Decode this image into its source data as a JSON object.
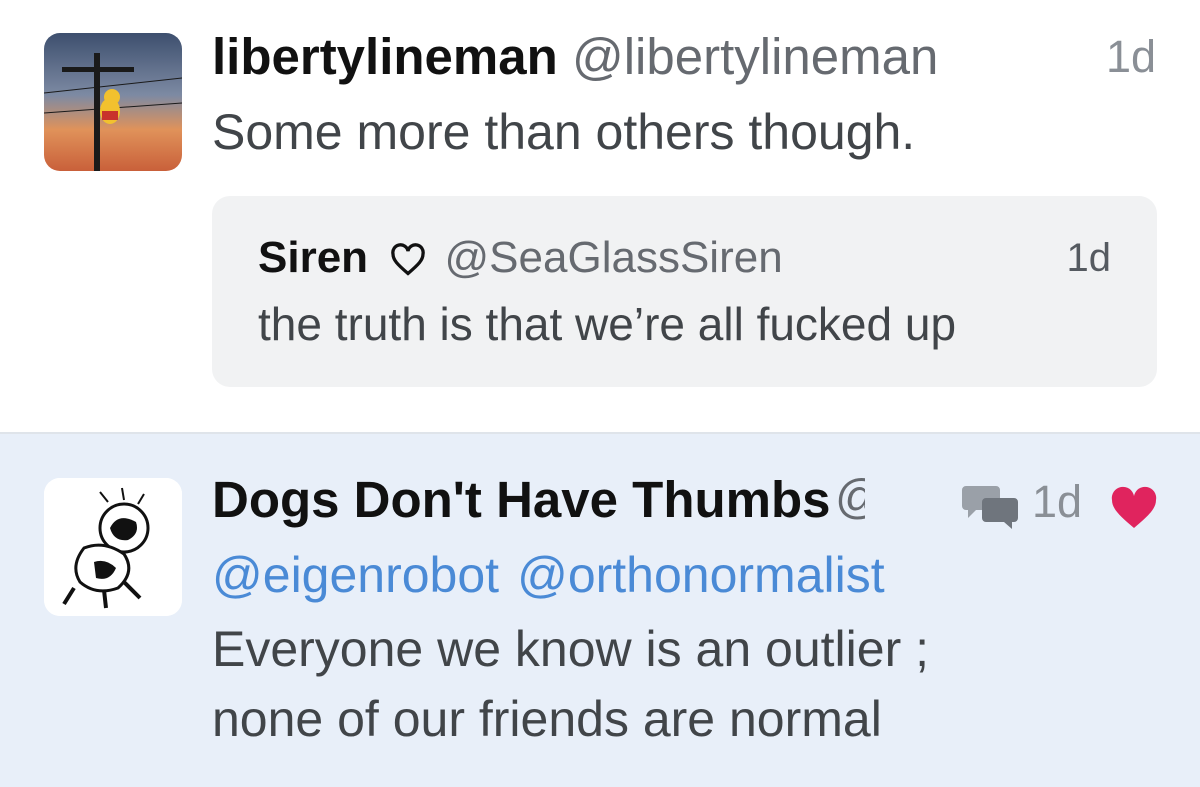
{
  "tweets": [
    {
      "user_name": "libertylineman",
      "handle": "@libertylineman",
      "time": "1d",
      "text": "Some more than others though.",
      "quote": {
        "user_name": "Siren",
        "name_icon": "heart-outline-icon",
        "handle": "@SeaGlassSiren",
        "time": "1d",
        "text": "the truth is that we’re all fucked up"
      }
    },
    {
      "user_name": "Dogs Don't Have Thumbs",
      "handle": "@",
      "reply_icon": "reply-bubbles-icon",
      "time": "1d",
      "liked_icon": "heart-filled-icon",
      "mentions": [
        "@eigenrobot",
        "@orthonormalist"
      ],
      "text_lines": [
        "Everyone we know is an outlier ;",
        "none of our friends are normal"
      ]
    }
  ],
  "colors": {
    "highlight_bg": "#e8eff9",
    "mention": "#4a8ad6",
    "like": "#e0245e"
  }
}
